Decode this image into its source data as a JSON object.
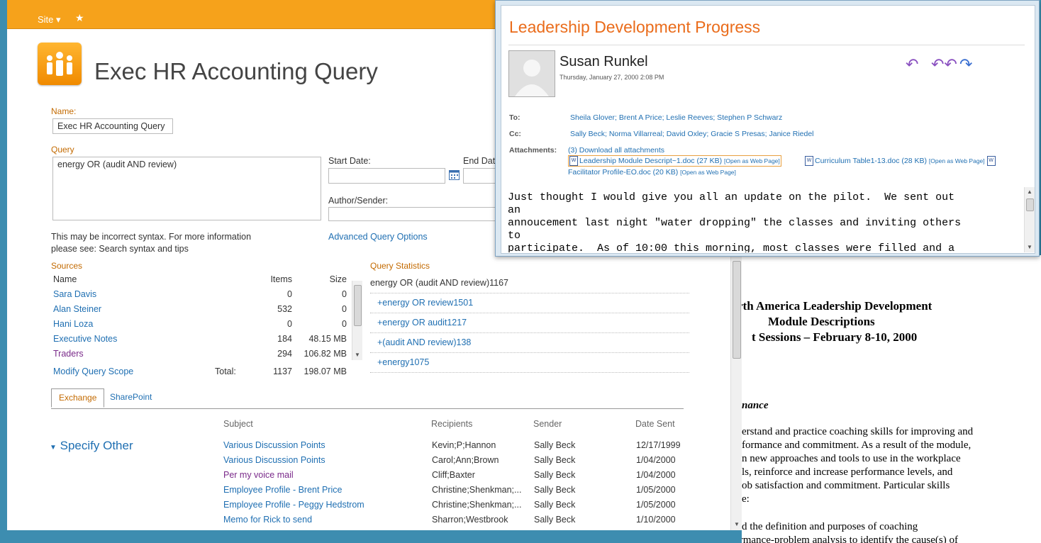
{
  "ribbon": {
    "site_label": "Site ▾",
    "star": "★"
  },
  "page": {
    "title": "Exec HR Accounting Query"
  },
  "form": {
    "name_label": "Name:",
    "name_value": "Exec HR Accounting Query",
    "query_label": "Query",
    "query_value": "energy OR (audit AND review)",
    "syntax_hint": "This may be incorrect syntax. For more information please see: Search syntax and tips",
    "start_date_label": "Start Date:",
    "end_date_label": "End Dat",
    "author_label": "Author/Sender:",
    "advanced_link": "Advanced Query Options"
  },
  "sources": {
    "title": "Sources",
    "headers": {
      "name": "Name",
      "items": "Items",
      "size": "Size"
    },
    "rows": [
      {
        "name": "Sara Davis",
        "items": "0",
        "size": "0"
      },
      {
        "name": "Alan Steiner",
        "items": "532",
        "size": "0"
      },
      {
        "name": "Hani Loza",
        "items": "0",
        "size": "0"
      },
      {
        "name": "Executive Notes",
        "items": "184",
        "size": "48.15 MB"
      },
      {
        "name": "Traders",
        "items": "294",
        "size": "106.82 MB"
      }
    ],
    "modify_link": "Modify Query Scope",
    "total_label": "Total:",
    "total_items": "1137",
    "total_size": "198.07 MB"
  },
  "query_stats": {
    "title": "Query Statistics",
    "rows": [
      {
        "text": "energy OR (audit AND review)1167"
      },
      {
        "text": "+energy OR review1501"
      },
      {
        "text": "+energy OR audit1217"
      },
      {
        "text": "+(audit AND review)138"
      },
      {
        "text": "+energy1075"
      }
    ]
  },
  "tabs": [
    {
      "label": "Exchange"
    },
    {
      "label": "SharePoint"
    }
  ],
  "results": {
    "specify_other": "Specify Other",
    "headers": {
      "subject": "Subject",
      "recipients": "Recipients",
      "sender": "Sender",
      "date": "Date Sent"
    },
    "rows": [
      {
        "subject": "Various Discussion Points",
        "recipients": "Kevin;P;Hannon",
        "sender": "Sally Beck",
        "date": "12/17/1999"
      },
      {
        "subject": "Various Discussion Points",
        "recipients": "Carol;Ann;Brown",
        "sender": "Sally Beck",
        "date": "1/04/2000"
      },
      {
        "subject": "Per my voice mail",
        "recipients": "Cliff;Baxter",
        "sender": "Sally Beck",
        "date": "1/04/2000"
      },
      {
        "subject": "Employee Profile - Brent Price",
        "recipients": "Christine;Shenkman;...",
        "sender": "Sally Beck",
        "date": "1/05/2000"
      },
      {
        "subject": "Employee Profile - Peggy Hedstrom",
        "recipients": "Christine;Shenkman;...",
        "sender": "Sally Beck",
        "date": "1/05/2000"
      },
      {
        "subject": "Memo for Rick to send",
        "recipients": "Sharron;Westbrook",
        "sender": "Sally Beck",
        "date": "1/10/2000"
      }
    ]
  },
  "mail": {
    "title": "Leadership Development Progress",
    "sender": "Susan Runkel",
    "sent": "Thursday, January 27, 2000 2:08 PM",
    "to_label": "To:",
    "to": "Sheila Glover; Brent A Price; Leslie Reeves; Stephen P Schwarz",
    "cc_label": "Cc:",
    "cc": "Sally Beck; Norma Villarreal; David Oxley; Gracie S Presas; Janice Riedel",
    "attachments_label": "Attachments:",
    "attachments_count": "(3)  Download all attachments",
    "attachments": [
      {
        "name": "Leadership Module Descript~1.doc (27 KB)",
        "open": "[Open as Web Page]"
      },
      {
        "name": "Curriculum Table1-13.doc (28 KB)",
        "open": "[Open as Web Page]"
      },
      {
        "name": "Facilitator Profile-EO.doc (20 KB)",
        "open": "[Open as Web Page]"
      }
    ],
    "body": "Just thought I would give you all an update on the pilot.  We sent out\nan\nannoucement last night \"water dropping\" the classes and inviting others\nto\nparticipate.  As of 10:00 this morning, most classes were filled and a"
  },
  "document": {
    "lines": [
      "rth America Leadership Development",
      "Module Descriptions",
      "t Sessions – February 8-10, 2000",
      "nance",
      "erstand and practice coaching skills for improving and",
      "formance and commitment.  As a result of the module,",
      "n new approaches and tools to use in the workplace",
      "ls, reinforce and increase performance levels, and",
      "ob satisfaction and commitment.  Particular skills",
      "e:",
      "d the definition and purposes of coaching",
      "Use performance-problem analysis to identify the cause(s) of"
    ]
  }
}
